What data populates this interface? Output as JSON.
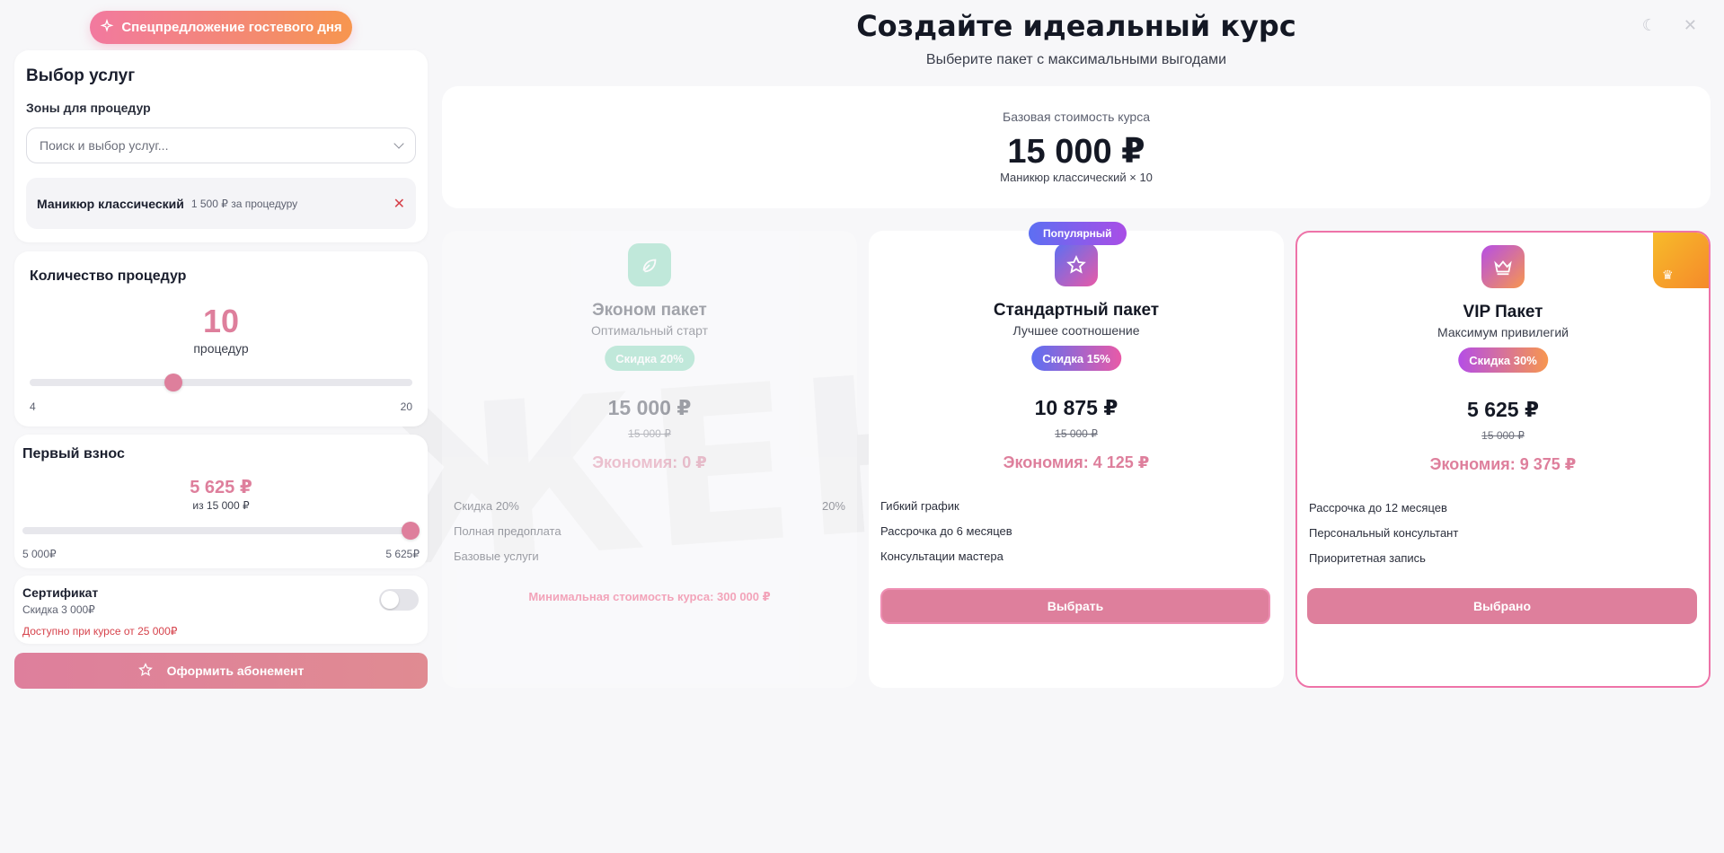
{
  "special_offer": "Спецпредложение гостевого дня",
  "services": {
    "title": "Выбор услуг",
    "zones_label": "Зоны для процедур",
    "search_placeholder": "Поиск и выбор услуг...",
    "selected": {
      "name": "Маникюр классический",
      "price": "1 500 ₽ за процедуру"
    }
  },
  "quantity": {
    "title": "Количество процедур",
    "value": "10",
    "unit": "процедур",
    "min": "4",
    "max": "20",
    "position": 0.375
  },
  "first_payment": {
    "title": "Первый взнос",
    "amount": "5 625 ₽",
    "of_total": "из 15 000 ₽",
    "min": "5 000₽",
    "max": "5 625₽",
    "position": 1.0
  },
  "certificate": {
    "title": "Сертификат",
    "discount": "Скидка 3 000₽",
    "warning": "Доступно при курсе от 25 000₽",
    "enabled": false
  },
  "subscribe_button": "Оформить абонемент",
  "hero": {
    "title": "Создайте идеальный курс",
    "subtitle": "Выберите пакет с максимальными выгодами"
  },
  "base": {
    "label": "Базовая стоимость курса",
    "price": "15 000 ₽",
    "desc": "Маникюр классический × 10"
  },
  "watermark": "ЖЕНІ",
  "packages": {
    "econom": {
      "name": "Эконом пакет",
      "tagline": "Оптимальный старт",
      "discount": "Скидка 20%",
      "price": "15 000 ₽",
      "old_price": "15 000 ₽",
      "economy": "Экономия: 0 ₽",
      "features": [
        "Скидка 20%",
        "Полная предоплата",
        "Базовые услуги"
      ],
      "feature_value": "20%",
      "minimum": "Минимальная стоимость курса: 300 000 ₽",
      "color": "#7fd6b5"
    },
    "standard": {
      "badge": "Популярный",
      "name": "Стандартный пакет",
      "tagline": "Лучшее соотношение",
      "discount": "Скидка 15%",
      "price": "10 875 ₽",
      "old_price": "15 000 ₽",
      "economy": "Экономия: 4 125 ₽",
      "features": [
        "Гибкий график",
        "Рассрочка до 6 месяцев",
        "Консультации мастера"
      ],
      "button": "Выбрать"
    },
    "vip": {
      "name": "VIP Пакет",
      "tagline": "Максимум привилегий",
      "discount": "Скидка 30%",
      "price": "5 625 ₽",
      "old_price": "15 000 ₽",
      "economy": "Экономия: 9 375 ₽",
      "features": [
        "Рассрочка до 12 месяцев",
        "Персональный консультант",
        "Приоритетная запись"
      ],
      "button": "Выбрано"
    }
  },
  "colors": {
    "accent": "#de7f9c",
    "vip_border": "#ee73a8",
    "danger": "#d6424b"
  },
  "icons": {
    "special": "sparkles-icon",
    "subscribe": "star-icon",
    "econom": "leaf-icon",
    "standard": "star-icon",
    "vip": "crown-icon",
    "theme": "moon-icon",
    "close": "close-icon"
  }
}
